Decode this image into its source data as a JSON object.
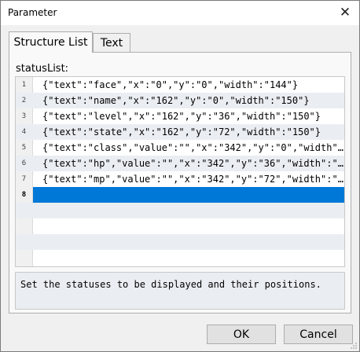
{
  "window": {
    "title": "Parameter",
    "close_glyph": "✕"
  },
  "tabs": [
    {
      "label": "Structure List",
      "active": true
    },
    {
      "label": "Text",
      "active": false
    }
  ],
  "list": {
    "label": "statusList:",
    "rows": [
      {
        "num": "1",
        "text": "{\"text\":\"face\",\"x\":\"0\",\"y\":\"0\",\"width\":\"144\"}"
      },
      {
        "num": "2",
        "text": "{\"text\":\"name\",\"x\":\"162\",\"y\":\"0\",\"width\":\"150\"}"
      },
      {
        "num": "3",
        "text": "{\"text\":\"level\",\"x\":\"162\",\"y\":\"36\",\"width\":\"150\"}"
      },
      {
        "num": "4",
        "text": "{\"text\":\"state\",\"x\":\"162\",\"y\":\"72\",\"width\":\"150\"}"
      },
      {
        "num": "5",
        "text": "{\"text\":\"class\",\"value\":\"\",\"x\":\"342\",\"y\":\"0\",\"width\":\"…"
      },
      {
        "num": "6",
        "text": "{\"text\":\"hp\",\"value\":\"\",\"x\":\"342\",\"y\":\"36\",\"width\":\"19…"
      },
      {
        "num": "7",
        "text": "{\"text\":\"mp\",\"value\":\"\",\"x\":\"342\",\"y\":\"72\",\"width\":\"19…"
      },
      {
        "num": "8",
        "text": ""
      }
    ]
  },
  "description": "Set the statuses to be displayed and their positions.",
  "buttons": {
    "ok": "OK",
    "cancel": "Cancel"
  },
  "colors": {
    "selection": "#0078d7",
    "alt_row": "#eaeef2"
  }
}
